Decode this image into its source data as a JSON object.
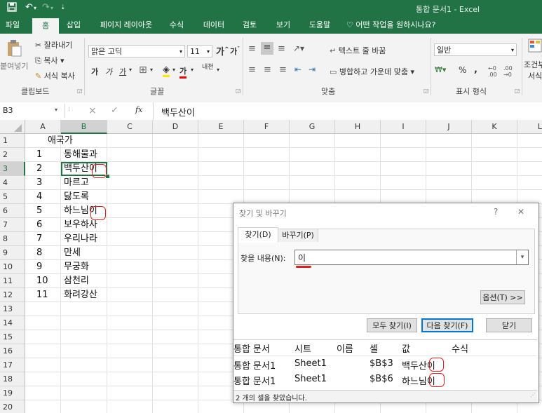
{
  "window": {
    "title": "통합 문서1 - Excel"
  },
  "tabs": [
    {
      "label": "파일",
      "active": false
    },
    {
      "label": "홈",
      "active": true
    },
    {
      "label": "삽입",
      "active": false
    },
    {
      "label": "페이지 레이아웃",
      "active": false
    },
    {
      "label": "수식",
      "active": false
    },
    {
      "label": "데이터",
      "active": false
    },
    {
      "label": "검토",
      "active": false
    },
    {
      "label": "보기",
      "active": false
    },
    {
      "label": "도움말",
      "active": false
    }
  ],
  "tell_me": "어떤 작업을 원하시나요?",
  "ribbon": {
    "clipboard": {
      "paste": "붙여넣기",
      "cut": "잘라내기",
      "copy": "복사",
      "format_painter": "서식 복사",
      "label": "클립보드"
    },
    "font": {
      "name": "맑은 고딕",
      "size": "11",
      "grow": "가",
      "shrink": "가",
      "bold": "가",
      "italic": "가",
      "underline": "가",
      "font_color": "가",
      "phonetic": "내천",
      "label": "글꼴"
    },
    "alignment": {
      "wrap_text": "텍스트 줄 바꿈",
      "merge": "병합하고 가운데 맞춤",
      "label": "맞춤"
    },
    "number": {
      "format": "일반",
      "percent": "%",
      "comma": ",",
      "label": "표시 형식"
    },
    "styles": {
      "cond_line1": "조건부",
      "cond_line2": "서식"
    }
  },
  "formula_bar": {
    "name_box": "B3",
    "cancel": "×",
    "enter": "✓",
    "fx": "fx",
    "value": "백두산이"
  },
  "columns": [
    "A",
    "B",
    "C",
    "D",
    "E",
    "F",
    "G",
    "H",
    "I",
    "J",
    "K",
    "L"
  ],
  "rows": [
    "1",
    "2",
    "3",
    "4",
    "5",
    "6",
    "7",
    "8",
    "9",
    "10",
    "11",
    "12",
    "13",
    "14",
    "15",
    "16",
    "17",
    "18",
    "19",
    "20"
  ],
  "sheet": {
    "header": "애국가",
    "entries": [
      {
        "num": "1",
        "text": "동해물과"
      },
      {
        "num": "2",
        "text": "백두산이"
      },
      {
        "num": "3",
        "text": "마르고"
      },
      {
        "num": "4",
        "text": "닳도록"
      },
      {
        "num": "5",
        "text": "하느님이"
      },
      {
        "num": "6",
        "text": "보우하사"
      },
      {
        "num": "7",
        "text": "우리나라"
      },
      {
        "num": "8",
        "text": "만세"
      },
      {
        "num": "9",
        "text": "무궁화"
      },
      {
        "num": "10",
        "text": "삼천리"
      },
      {
        "num": "11",
        "text": "화려강산"
      }
    ]
  },
  "dialog": {
    "title": "찾기 및 바꾸기",
    "help": "?",
    "close": "✕",
    "tab_find": "찾기(D)",
    "tab_replace": "바꾸기(P)",
    "find_label": "찾을 내용(N):",
    "find_value": "이",
    "options": "옵션(T) >>",
    "find_all": "모두 찾기(I)",
    "find_next": "다음 찾기(F)",
    "close_btn": "닫기",
    "result_headers": [
      "통합 문서",
      "시트",
      "이름",
      "셀",
      "값",
      "수식"
    ],
    "results": [
      {
        "book": "통합 문서1",
        "sheet": "Sheet1",
        "name": "",
        "cell": "$B$3",
        "value": "백두산이",
        "formula": ""
      },
      {
        "book": "통합 문서1",
        "sheet": "Sheet1",
        "name": "",
        "cell": "$B$6",
        "value": "하느님이",
        "formula": ""
      }
    ],
    "status": "2 개의 셀을 찾았습니다."
  },
  "colors": {
    "excel_green": "#217346",
    "annotation_red": "#e02020"
  }
}
